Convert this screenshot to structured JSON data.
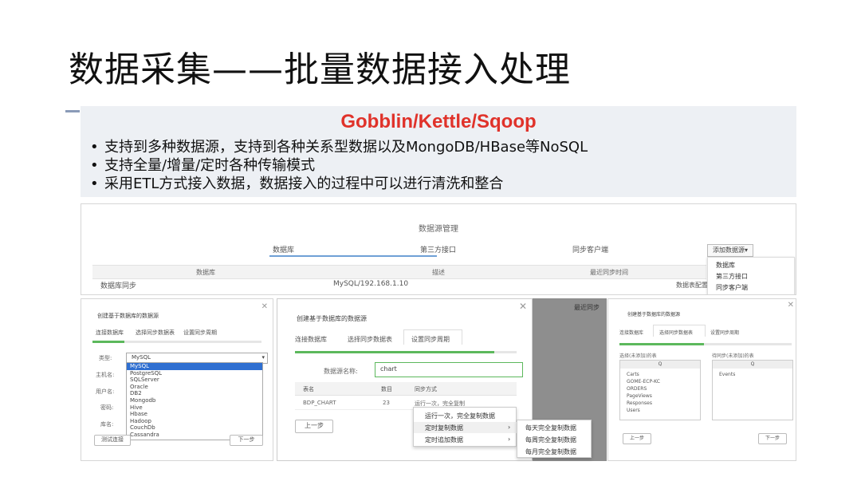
{
  "slide": {
    "title": "数据采集——批量数据接入处理"
  },
  "intro": {
    "brand": "Gobblin/Kettle/Sqoop",
    "bullets": [
      "支持到多种数据源，支持到各种关系型数据以及MongoDB/HBase等NoSQL",
      "支持全量/增量/定时各种传输模式",
      "采用ETL方式接入数据，数据接入的过程中可以进行清洗和整合"
    ],
    "bullet_symbol": "•"
  },
  "datasource_manager": {
    "title": "数据源管理",
    "tabs": [
      "数据库",
      "第三方接口",
      "同步客户端"
    ],
    "add_button": "添加数据源▾",
    "columns": [
      "数据库",
      "描述",
      "最近同步时间"
    ],
    "row": {
      "name": "数据库同步",
      "desc": "MySQL/192.168.1.10",
      "op": "数据表配置"
    },
    "add_menu": [
      "数据库",
      "第三方接口",
      "同步客户端"
    ]
  },
  "dialog1": {
    "title": "创建基于数据库的数据源",
    "tabs": [
      "连接数据库",
      "选择同步数据表",
      "设置同步周期"
    ],
    "labels": [
      "类型:",
      "主机名:",
      "用户名:",
      "密码:",
      "库名:"
    ],
    "select_value": "MySQL",
    "options": [
      "MySQL",
      "PostgreSQL",
      "SQLServer",
      "Oracle",
      "DB2",
      "Mongodb",
      "Hive",
      "Hbase",
      "Hadoop",
      "CouchDb",
      "Cassandra"
    ],
    "test_button": "测试连接",
    "next_button": "下一步",
    "close": "✕"
  },
  "dialog2": {
    "title": "创建基于数据库的数据源",
    "tabs": [
      "连接数据库",
      "选择同步数据表",
      "设置同步周期"
    ],
    "name_label": "数据源名称:",
    "name_value": "chart",
    "columns": [
      "表名",
      "数目",
      "同步方式"
    ],
    "row": {
      "table": "BDP_CHART",
      "count": "23",
      "mode": "运行一次，完全复制"
    },
    "prev_button": "上一步",
    "close": "✕",
    "context_menu": [
      "运行一次，完全复制数据",
      "定时复制数据",
      "定时追加数据"
    ],
    "submenu": [
      "每天完全复制数据",
      "每周完全复制数据",
      "每月完全复制数据"
    ],
    "arrow": "›",
    "bg_header": "最近同步"
  },
  "dialog3": {
    "title": "创建基于数据库的数据源",
    "tabs": [
      "连接数据库",
      "选择同步数据表",
      "设置同步周期"
    ],
    "left_label": "选择(未添加)的表",
    "right_label": "待同步(未添加)的表",
    "search_icon": "Q",
    "left_items": [
      "Carts",
      "GOME-ECP-KC",
      "ORDERS",
      "PageViews",
      "Responses",
      "Users"
    ],
    "right_items": [
      "Events"
    ],
    "prev_button": "上一步",
    "next_button": "下一步",
    "close": "✕"
  },
  "colors": {
    "brand": "#e0322a",
    "progress": "#5cb85c",
    "selected": "#2f6fd1"
  }
}
